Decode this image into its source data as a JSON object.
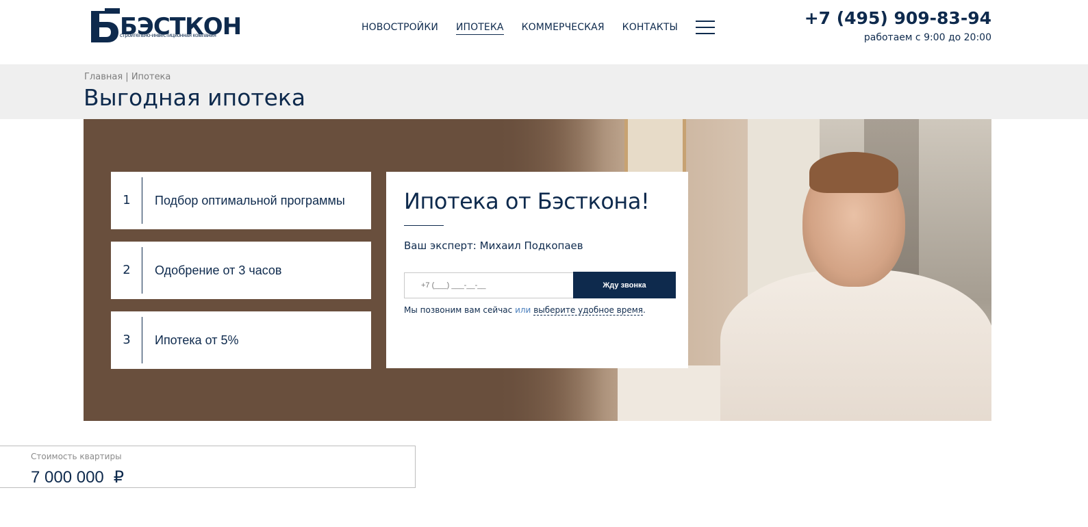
{
  "header": {
    "logo_text": "БЭСТКОН",
    "logo_subtitle": "строительно-инвестиционная компания",
    "nav": [
      {
        "label": "НОВОСТРОЙКИ",
        "active": false
      },
      {
        "label": "ИПОТЕКА",
        "active": true
      },
      {
        "label": "КОММЕРЧЕСКАЯ",
        "active": false
      },
      {
        "label": "КОНТАКТЫ",
        "active": false
      }
    ],
    "menu_icon": "hamburger-menu-icon",
    "phone": "+7 (495) 909-83-94",
    "hours": "работаем с 9:00 до 20:00"
  },
  "breadcrumb": {
    "home": "Главная",
    "separator": " | ",
    "current": "Ипотека"
  },
  "page_title": "Выгодная ипотека",
  "steps": [
    {
      "num": "1",
      "label": "Подбор оптимальной программы"
    },
    {
      "num": "2",
      "label": "Одобрение от 3 часов"
    },
    {
      "num": "3",
      "label": "Ипотека от 5%"
    }
  ],
  "card": {
    "title": "Ипотека от Бэсткона!",
    "expert": "Ваш эксперт: Михаил Подкопаев",
    "phone_placeholder": "+7 (___) ___-__-__",
    "button": "Жду звонка",
    "note_part1": "Мы позвоним вам сейчас ",
    "note_or": "или",
    "note_link": "выберите удобное время",
    "note_end": "."
  },
  "calculator": {
    "label": "Стоимость квартиры",
    "value": "7 000 000",
    "currency": "₽"
  },
  "colors": {
    "brand_navy": "#0e2a4d",
    "hero_brown": "#694f3d",
    "title_band": "#efefef",
    "link_blue": "#4a7fbd"
  }
}
